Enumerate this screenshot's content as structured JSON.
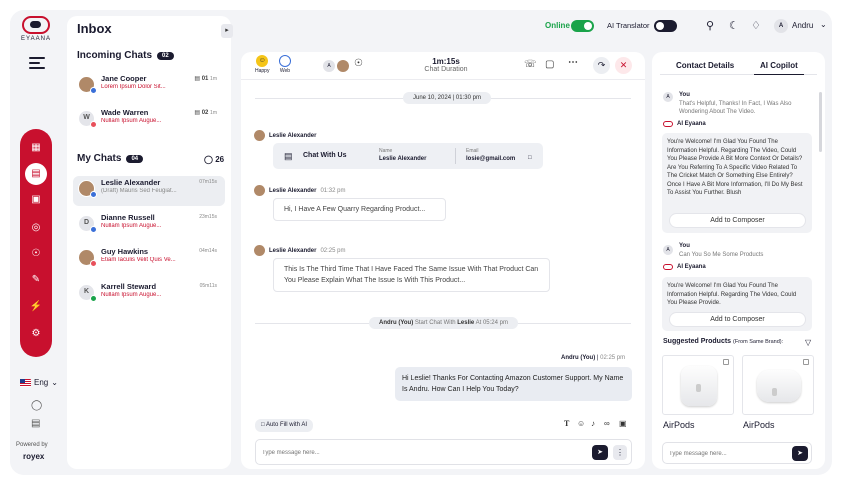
{
  "brand": {
    "name": "EYAANA",
    "powered_by": "Powered by",
    "vendor": "royex",
    "accent": "#c8102e"
  },
  "language": "Eng",
  "inbox": {
    "title": "Inbox",
    "incoming": {
      "title": "Incoming Chats",
      "count": "02",
      "items": [
        {
          "name": "Jane Cooper",
          "preview": "Lorem Ipsum Dolor Sit...",
          "meta": "01",
          "time": "1m"
        },
        {
          "name": "Wade Warren",
          "initial": "W",
          "preview": "Nullam Ipsum Augue...",
          "meta": "02",
          "time": "1m"
        }
      ]
    },
    "mychats": {
      "title": "My Chats",
      "count": "04",
      "total": "26",
      "items": [
        {
          "name": "Leslie Alexander",
          "preview": "(Draft) Mauris Sed Feugiat...",
          "time": "07m15s"
        },
        {
          "name": "Dianne Russell",
          "initial": "D",
          "preview": "Nullam Ipsum Augue...",
          "time": "23m15s"
        },
        {
          "name": "Guy Hawkins",
          "preview": "Etiam Iaculis Velit Quis Ve...",
          "time": "04m14s"
        },
        {
          "name": "Karrell Steward",
          "initial": "K",
          "preview": "Nullam Ipsum Augue...",
          "time": "05m11s"
        }
      ]
    }
  },
  "topbar": {
    "online_label": "Online",
    "online_on": true,
    "ai_translator_label": "AI Translator",
    "ai_translator_on": false,
    "user_initial": "A",
    "user_name": "Andru"
  },
  "chat": {
    "mood_label": "Happy",
    "channel_label": "Web",
    "participant_initial": "A",
    "duration_value": "1m:15s",
    "duration_label": "Chat Duration",
    "date": "June 10, 2024 | 01:30 pm",
    "card_sender": "Leslie Alexander",
    "card": {
      "title": "Chat With Us",
      "name_label": "Name",
      "name_value": "Leslie Alexander",
      "email_label": "Email",
      "email_value": "losie@gmail.com"
    },
    "messages_in": [
      {
        "sender": "Leslie Alexander",
        "time": "01:32 pm",
        "text": "Hi, I Have A Few Quarry Regarding Product..."
      },
      {
        "sender": "Leslie Alexander",
        "time": "02:25 pm",
        "text": "This Is The Third Time That I Have Faced The Same Issue With That Product Can You Please Explain What The Issue Is With This Product..."
      }
    ],
    "system": {
      "agent": "Andru (You)",
      "action": "Start Chat With",
      "customer": "Leslie",
      "time": "At 05:24 pm"
    },
    "message_out": {
      "sender": "Andru (You)",
      "time": "02:25 pm",
      "text": "Hi Leslie! Thanks For Contacting Amazon Customer Support. My Name Is Andru. How Can I Help You Today?"
    },
    "autofill_label": "Auto Fill with AI",
    "composer_placeholder": "Type message here..."
  },
  "copilot": {
    "tabs": [
      "Contact Details",
      "AI Copilot"
    ],
    "active_tab": "AI Copilot",
    "q1": {
      "who": "You",
      "text": "That's Helpful, Thanks! In Fact, I Was Also Wondering About The Video."
    },
    "ai_name": "AI Eyaana",
    "a1": "You're Welcome! I'm Glad You Found The Information Helpful. Regarding The Video, Could You Please Provide A Bit More Context Or Details? Are You Referring To A Specific Video Related To The Cricket Match Or Something Else Entirely? Once I Have A Bit More Information, I'll Do My Best To Assist You Further. Blush",
    "add_label": "Add to Composer",
    "q2": {
      "who": "You",
      "text": "Can You So Me Some Products"
    },
    "a2": "You're Welcome! I'm Glad You Found The Information Helpful. Regarding The Video, Could You Please Provide.",
    "suggested_title": "Suggested Products",
    "suggested_sub": "(From Same Brand):",
    "products": [
      {
        "name": "AirPods"
      },
      {
        "name": "AirPods"
      }
    ],
    "input_placeholder": "Type message here..."
  }
}
